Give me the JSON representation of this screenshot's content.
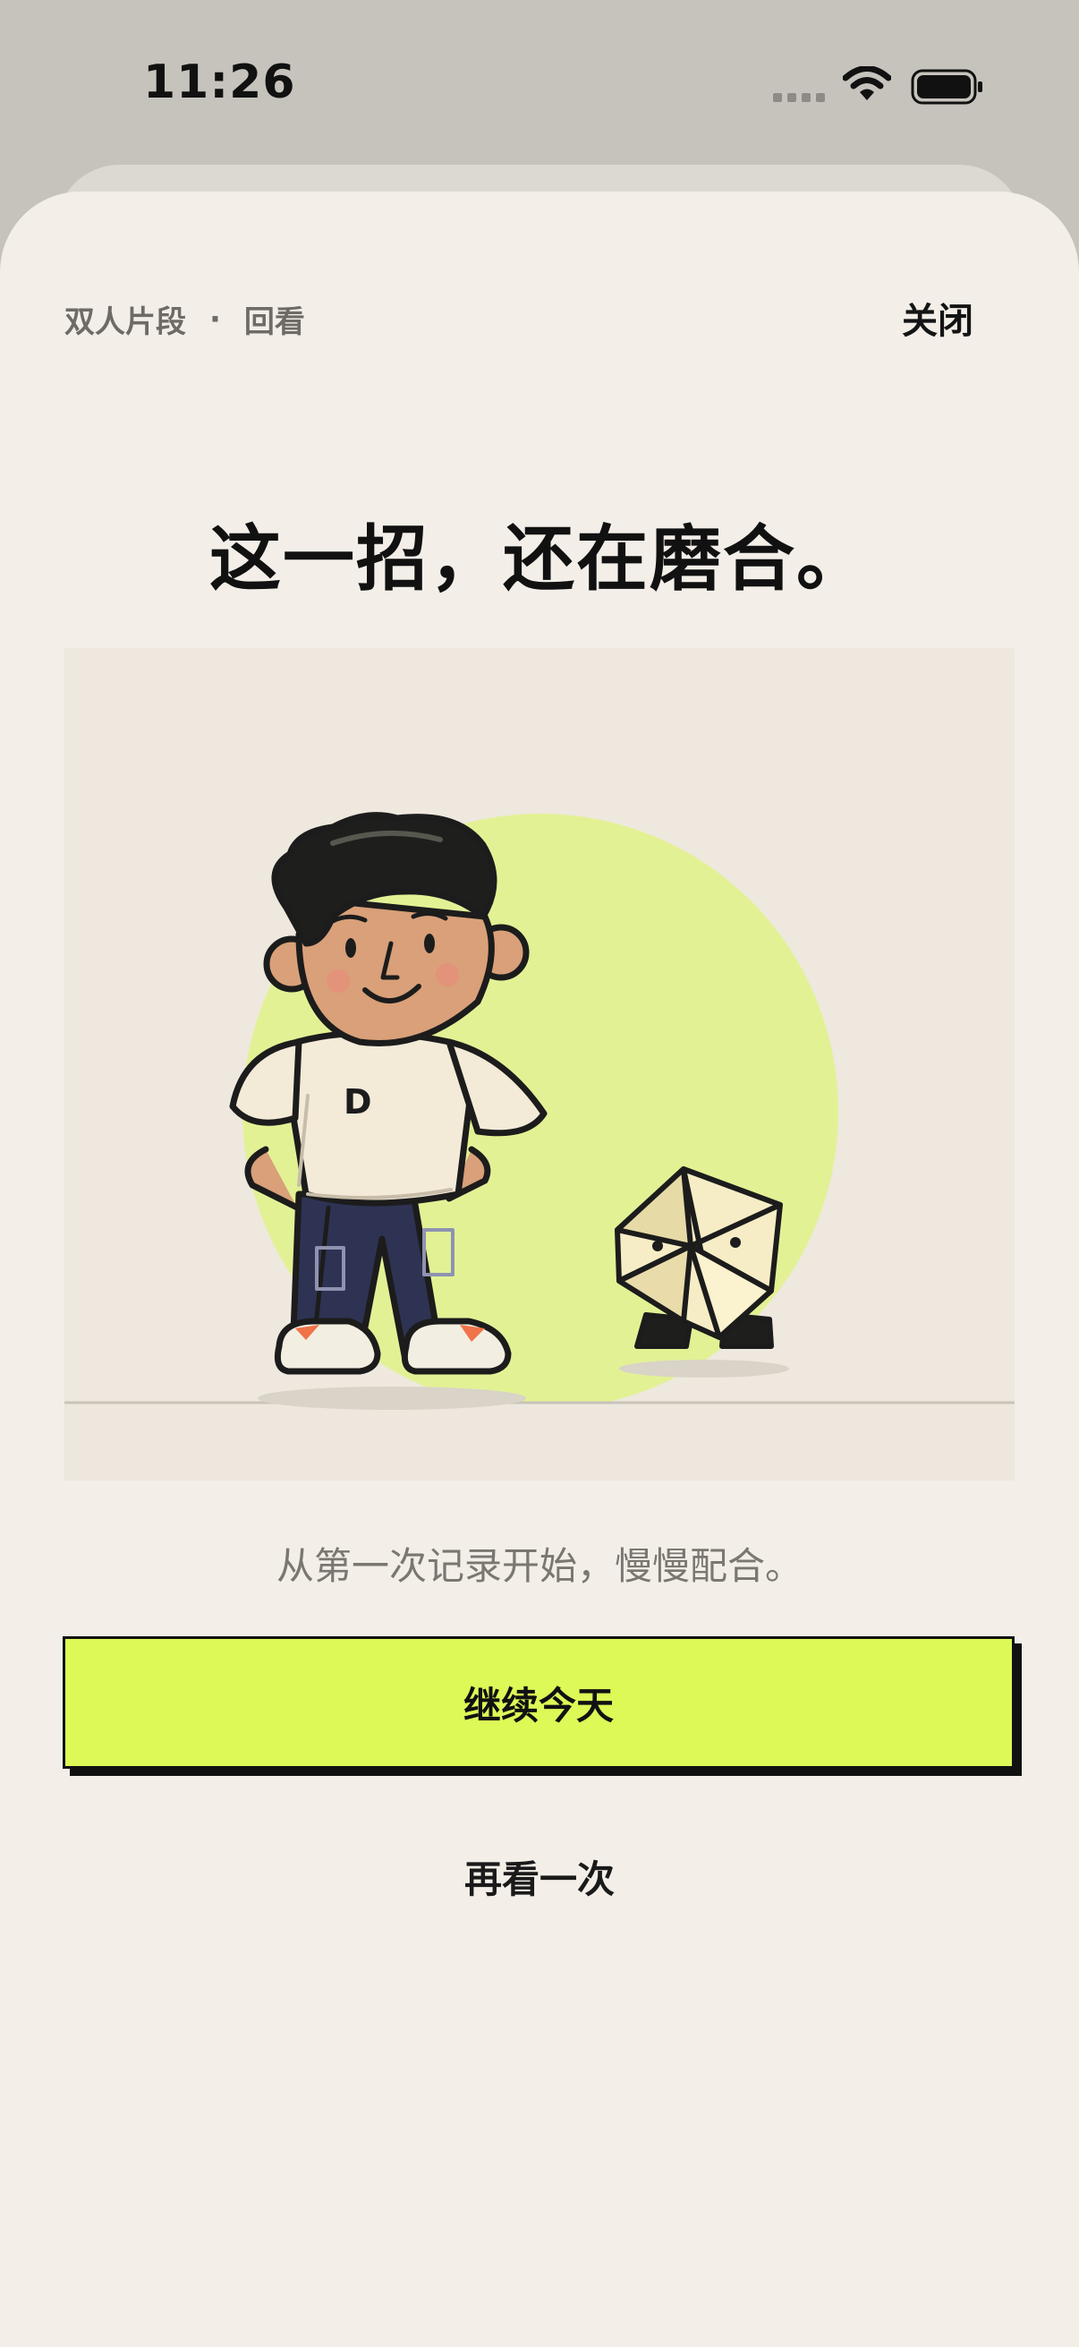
{
  "status_bar": {
    "time": "11:26",
    "icons": [
      "cellular-icon",
      "wifi-icon",
      "battery-icon"
    ]
  },
  "header": {
    "crumb_left": "双人片段",
    "crumb_separator": "·",
    "crumb_right": "回看",
    "close_label": "关闭"
  },
  "main": {
    "title": "这一招，还在磨合。",
    "illustration": {
      "shirt_letter": "D",
      "elements": [
        "boy-character",
        "origami-creature",
        "green-sun-circle",
        "ground-line"
      ]
    },
    "subtitle": "从第一次记录开始，慢慢配合。"
  },
  "actions": {
    "primary_label": "继续今天",
    "secondary_label": "再看一次"
  },
  "colors": {
    "accent": "#DCF957",
    "sheet_background": "#F3EFE8",
    "illustration_background": "#EEE8DE",
    "sun_circle": "#E3F195",
    "text_primary": "#111111",
    "text_muted": "#7A7771"
  }
}
